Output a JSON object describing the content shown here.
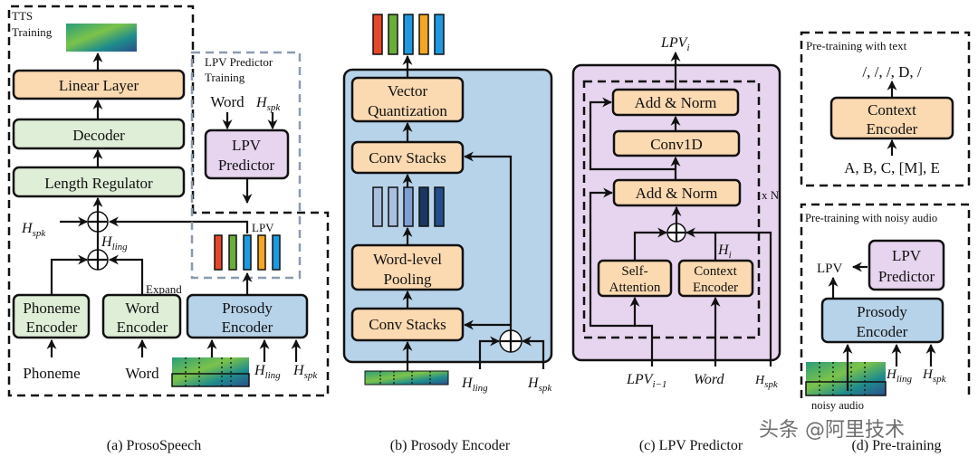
{
  "colors": {
    "peach": "#fbd9b1",
    "green": "#dfeed7",
    "blue": "#b7d3ea",
    "purple": "#e7d4ef",
    "bar_red": "#e8472a",
    "bar_green": "#6aae3a",
    "bar_blue": "#1f9ae0",
    "bar_orange": "#f5a623"
  },
  "a": {
    "tts_training": [
      "TTS",
      "Training"
    ],
    "linear_layer": "Linear Layer",
    "decoder": "Decoder",
    "length_regulator": "Length Regulator",
    "phoneme_encoder": [
      "Phoneme",
      "Encoder"
    ],
    "word_encoder": [
      "Word",
      "Encoder"
    ],
    "prosody_encoder": [
      "Prosody",
      "Encoder"
    ],
    "expand": "Expand",
    "phoneme": "Phoneme",
    "word": "Word",
    "h_spk": {
      "main": "H",
      "sub": "spk"
    },
    "h_ling": {
      "main": "H",
      "sub": "ling"
    },
    "lpv_training": [
      "LPV Predictor",
      "Training"
    ],
    "lpv_predictor": [
      "LPV",
      "Predictor"
    ],
    "lpv": "LPV",
    "caption": "(a) ProsoSpeech"
  },
  "b": {
    "vector_quantization": [
      "Vector",
      "Quantization"
    ],
    "conv_stacks": "Conv Stacks",
    "word_level_pooling": [
      "Word-level",
      "Pooling"
    ],
    "h_ling": {
      "main": "H",
      "sub": "ling"
    },
    "h_spk": {
      "main": "H",
      "sub": "spk"
    },
    "caption": "(b) Prosody Encoder"
  },
  "c": {
    "lpv_i": {
      "main": "LPV",
      "sub": "i"
    },
    "add_norm": "Add & Norm",
    "conv1d": "Conv1D",
    "self_attention": [
      "Self-",
      "Attention"
    ],
    "context_encoder": [
      "Context",
      "Encoder"
    ],
    "h_i": {
      "main": "H",
      "sub": "i"
    },
    "xn": "x N",
    "lpv_prev": {
      "main": "LPV",
      "sub": "i−1"
    },
    "word": "Word",
    "h_spk": {
      "main": "H",
      "sub": "spk"
    },
    "caption": "(c) LPV Predictor"
  },
  "d": {
    "text_title": "Pre-training with text",
    "outputs": "/,  /,  /,  D,  /",
    "context_encoder": [
      "Context",
      "Encoder"
    ],
    "inputs": "A, B, C, [M], E",
    "audio_title": "Pre-training with noisy audio",
    "lpv_predictor": [
      "LPV",
      "Predictor"
    ],
    "lpv": "LPV",
    "prosody_encoder": [
      "Prosody",
      "Encoder"
    ],
    "h_ling": {
      "main": "H",
      "sub": "ling"
    },
    "h_spk": {
      "main": "H",
      "sub": "spk"
    },
    "noisy_audio": "noisy audio",
    "caption": "(d) Pre-training"
  },
  "watermark": "头条 @阿里技术"
}
